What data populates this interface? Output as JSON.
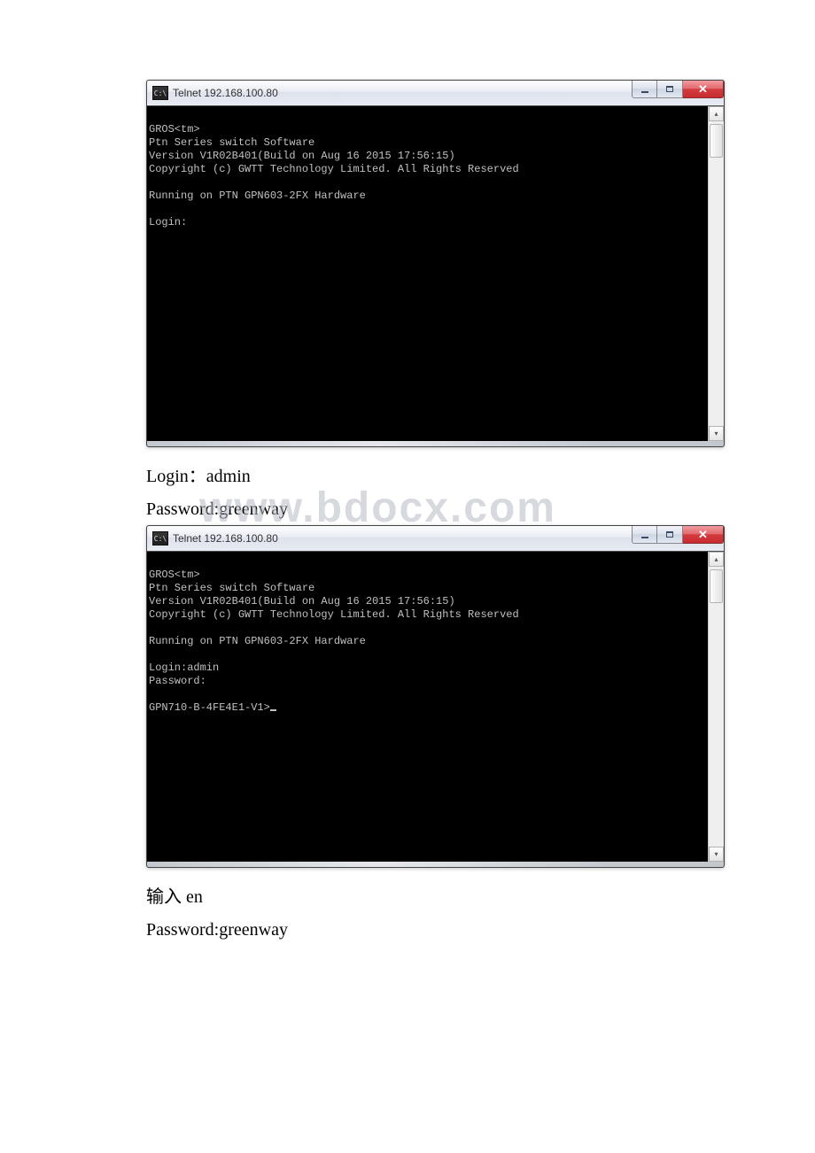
{
  "window1": {
    "title": "Telnet 192.168.100.80",
    "body": "\nGROS<tm>\nPtn Series switch Software\nVersion V1R02B401(Build on Aug 16 2015 17:56:15)\nCopyright (c) GWTT Technology Limited. All Rights Reserved\n\nRunning on PTN GPN603-2FX Hardware\n\nLogin:"
  },
  "text1": "Login：admin",
  "text2": "Password:greenway",
  "watermark": "www.bdocx.com",
  "window2": {
    "title": "Telnet 192.168.100.80",
    "body": "\nGROS<tm>\nPtn Series switch Software\nVersion V1R02B401(Build on Aug 16 2015 17:56:15)\nCopyright (c) GWTT Technology Limited. All Rights Reserved\n\nRunning on PTN GPN603-2FX Hardware\n\nLogin:admin\nPassword:\n\nGPN710-B-4FE4E1-V1>"
  },
  "text3": "输入 en",
  "text4": "Password:greenway"
}
